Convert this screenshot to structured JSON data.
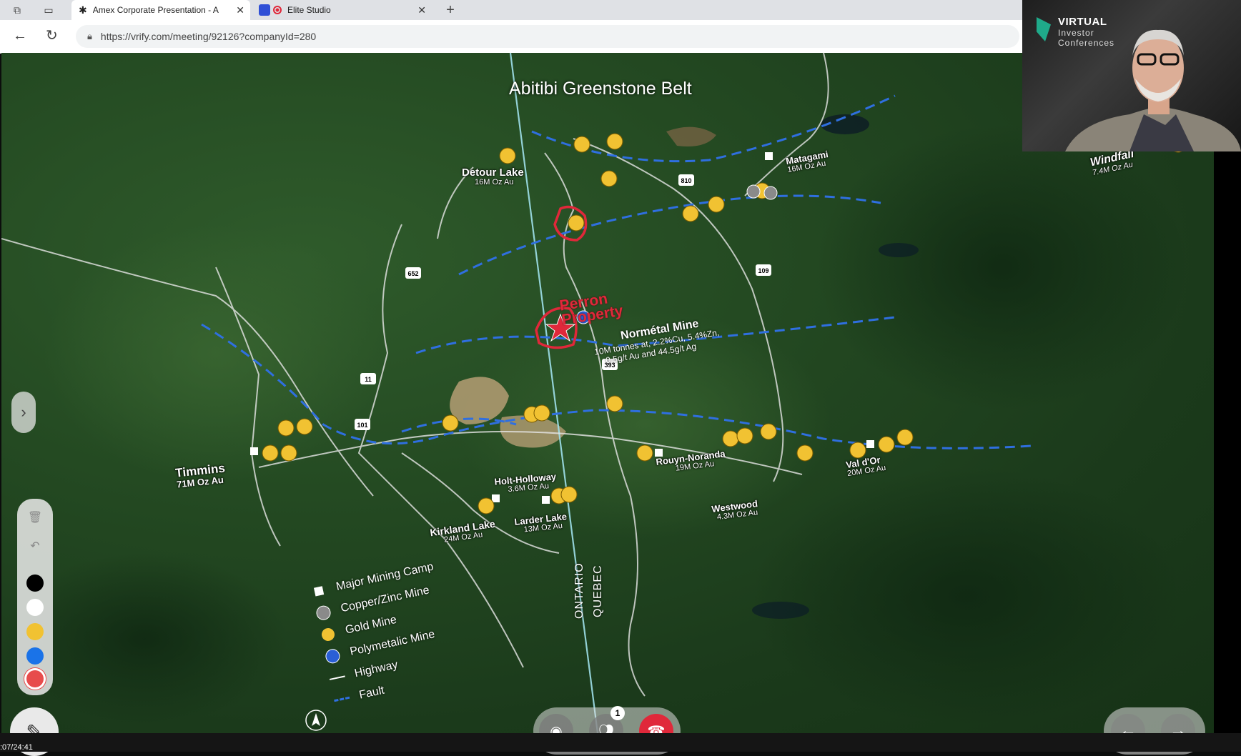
{
  "browser": {
    "tabs": [
      {
        "title": "Amex Corporate Presentation - A",
        "active": true
      },
      {
        "title": "Elite Studio",
        "active": false
      }
    ],
    "url": "https://vrify.com/meeting/92126?companyId=280"
  },
  "map": {
    "title": "Abitibi Greenstone Belt",
    "property_label_1": "Perron",
    "property_label_2": "Property",
    "places": [
      {
        "name": "Detour Lake",
        "detail": "16M Oz Au"
      },
      {
        "name": "Matagami",
        "detail": "16M Oz Au"
      },
      {
        "name": "Windfall",
        "detail": "7.4M Oz Au"
      },
      {
        "name": "Timmins",
        "detail": "71M Oz Au"
      },
      {
        "name": "Holt-Holloway",
        "detail": "3.6M Oz Au"
      },
      {
        "name": "Kirkland Lake",
        "detail": "24M Oz Au"
      },
      {
        "name": "Larder Lake",
        "detail": "13M Oz Au"
      },
      {
        "name": "Rouyn-Noranda",
        "detail": "19M Oz Au"
      },
      {
        "name": "Westwood",
        "detail": "4.3M Oz Au"
      },
      {
        "name": "Val d'Or",
        "detail": "20M Oz Au"
      }
    ],
    "normetal": {
      "name": "Normétal Mine",
      "line1": "10M tonnes at, 2.2%Cu, 5.4%Zn,",
      "line2": "0.5g/t Au and 44.5g/t Ag"
    },
    "highways": [
      "652",
      "810",
      "109",
      "11",
      "101",
      "393"
    ],
    "provinces": {
      "west": "ONTARIO",
      "east": "QUEBEC"
    },
    "legend": [
      {
        "label": "Major Mining Camp",
        "symbol": "camp-square"
      },
      {
        "label": "Copper/Zinc Mine",
        "symbol": "grey-pickaxe"
      },
      {
        "label": "Gold Mine",
        "symbol": "gold-pickaxe"
      },
      {
        "label": "Polymetalic Mine",
        "symbol": "blue-pickaxe"
      },
      {
        "label": "Highway",
        "symbol": "white-line"
      },
      {
        "label": "Fault",
        "symbol": "blue-dash"
      }
    ]
  },
  "colors": {
    "gold": "#f1c232",
    "fault": "#2f6fe0",
    "perron": "#e0283a",
    "copper": "#8a8a8a",
    "poly": "#2a5fd6"
  },
  "call": {
    "participants_badge": "1"
  },
  "webcam": {
    "brand_line1": "VIRTUAL",
    "brand_line2": "Investor",
    "brand_line3": "Conferences"
  },
  "status": {
    "elapsed": ":07/24:41"
  }
}
